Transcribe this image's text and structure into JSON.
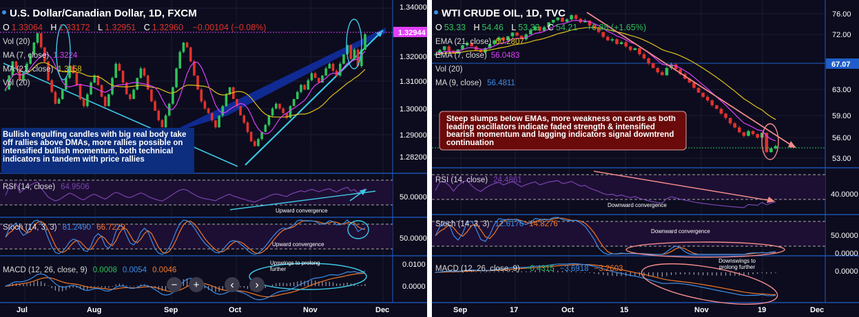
{
  "colors": {
    "background": "#0c0c1e",
    "pane_border": "#1f5ec9",
    "grid": "#1d1d33",
    "text": "#dadada",
    "bull": "#2fc15a",
    "bear": "#e0322d",
    "axis_text": "#ffffff",
    "price_line": "#e040fb",
    "annot_left_bg": "#0d2e7e",
    "annot_right_bg": "#6a0a0a",
    "cyan": "#3ec8e6",
    "salmon": "#f08a8a",
    "rsi_line": "#7a44b0",
    "stoch_k": "#3c8ee6",
    "stoch_d": "#f0782a",
    "ma7": "#e040fb",
    "ma21": "#e2c21a",
    "ema21": "#e2c21a",
    "ema7": "#e040fb",
    "ma9_vol": "#3c8ee6"
  },
  "left": {
    "header": {
      "title": "U.S. Dollar/Canadian Dollar, 1D, FXCM",
      "o_label": "O",
      "o": "1.33064",
      "h_label": "H",
      "h": "1.33172",
      "l_label": "L",
      "l": "1.32951",
      "c_label": "C",
      "c": "1.32960",
      "change": "−0.00104 (−0.08%)"
    },
    "legend": {
      "vol": "Vol (20)",
      "ma7_label": "MA (7, close)",
      "ma7_value": "1.3224",
      "ma21_label": "MA (21, close)",
      "ma21_value": "1.3158",
      "vol2": "Vol (20)"
    },
    "annotation": "Bullish engulfing candles with big real body take off rallies above DMAs, more rallies possible on intensified bullish momentum, both technical indicators in tandem with price rallies",
    "price_tag": "1.32944",
    "rsi": {
      "label": "RSI (14, close)",
      "value": "64.9506",
      "note": "Upward convergence"
    },
    "stoch": {
      "label": "Stoch (14, 3, 3)",
      "k": "81.2490",
      "d": "66.7229",
      "note": "Upward convergence"
    },
    "macd": {
      "label": "MACD (12, 26, close, 9)",
      "v1": "0.0008",
      "v2": "0.0054",
      "v3": "0.0046",
      "note": "Upswings to prolong further"
    },
    "toolbar": {
      "minus": "−",
      "plus": "+",
      "prev": "‹",
      "next": "›"
    }
  },
  "right": {
    "header": {
      "title": "WTI CRUDE OIL, 1D, TVC",
      "o_label": "O",
      "o": "53.33",
      "h_label": "H",
      "h": "54.46",
      "l_label": "L",
      "l": "53.33",
      "c_label": "C",
      "c": "54.21",
      "change": "+0.88 (+1.65%)"
    },
    "legend": {
      "ema21_label": "EMA (21, close)",
      "ema21_value": "60.2807",
      "ema7_label": "EMA (7, close)",
      "ema7_value": "56.0483",
      "vol": "Vol (20)",
      "ma9_label": "MA (9, close)",
      "ma9_value": "56.4811"
    },
    "annotation": "Steep slumps below EMAs, more weakness on cards as both leading oscillators indicate faded strength & intensified bearish momentum and lagging indicators signal downtrend continuation",
    "price_tag": "67.07",
    "rsi": {
      "label": "RSI (14, close)",
      "value": "24.4861",
      "note": "Downward convergence"
    },
    "stoch": {
      "label": "Stoch (14, 3, 3)",
      "k": "12.6176",
      "d": "14.8276",
      "note": "Downward convergence"
    },
    "macd": {
      "label": "MACD (12, 26, close, 9)",
      "v1": "−0.4315",
      "v2": "−3.6918",
      "v3": "−3.2603",
      "note": "Downswings to prolong further"
    }
  },
  "chart_data": [
    {
      "type": "candlestick",
      "title": "U.S. Dollar/Canadian Dollar, 1D, FXCM",
      "x_ticks": [
        "Jul",
        "Aug",
        "Sep",
        "Oct",
        "Nov",
        "Dec"
      ],
      "y_ticks": [
        "1.34000",
        "1.33000",
        "1.32000",
        "1.31000",
        "1.30000",
        "1.29000",
        "1.28200"
      ],
      "ylim": [
        1.2745,
        1.3415
      ],
      "close_series": [
        1.306,
        1.312,
        1.318,
        1.315,
        1.31,
        1.313,
        1.317,
        1.321,
        1.326,
        1.33,
        1.324,
        1.318,
        1.31,
        1.305,
        1.3,
        1.302,
        1.306,
        1.311,
        1.316,
        1.313,
        1.308,
        1.302,
        1.299,
        1.304,
        1.309,
        1.312,
        1.308,
        1.303,
        1.299,
        1.304,
        1.311,
        1.317,
        1.314,
        1.309,
        1.304,
        1.302,
        1.306,
        1.311,
        1.315,
        1.312,
        1.306,
        1.301,
        1.297,
        1.293,
        1.29,
        1.295,
        1.3,
        1.307,
        1.315,
        1.322,
        1.326,
        1.324,
        1.318,
        1.312,
        1.306,
        1.301,
        1.298,
        1.296,
        1.293,
        1.29,
        1.295,
        1.299,
        1.304,
        1.307,
        1.302,
        1.299,
        1.295,
        1.292,
        1.288,
        1.284,
        1.282,
        1.285,
        1.288,
        1.291,
        1.295,
        1.298,
        1.3,
        1.298,
        1.296,
        1.294,
        1.299,
        1.302,
        1.305,
        1.308,
        1.306,
        1.31,
        1.313,
        1.311,
        1.309,
        1.312,
        1.315,
        1.317,
        1.314,
        1.312,
        1.317,
        1.321,
        1.325,
        1.319,
        1.323,
        1.316,
        1.323,
        1.3296
      ],
      "rsi_value": 64.9506,
      "stoch": {
        "k": 81.249,
        "d": 66.7229
      },
      "macd": {
        "macd": 0.0054,
        "signal": 0.0046,
        "histogram": 0.0008
      },
      "annotations": [
        "Upward convergence",
        "Upward convergence",
        "Upswings to prolong further"
      ]
    },
    {
      "type": "candlestick",
      "title": "WTI CRUDE OIL, 1D, TVC",
      "x_ticks": [
        "Sep",
        "17",
        "Oct",
        "15",
        "Nov",
        "19",
        "Dec"
      ],
      "y_ticks": [
        "76.00",
        "72.00",
        "67.07",
        "63.00",
        "59.00",
        "56.00",
        "53.00"
      ],
      "ylim": [
        51.5,
        77.5
      ],
      "close_series": [
        69.5,
        70.2,
        70.8,
        70.1,
        69.6,
        70.3,
        71.0,
        71.4,
        70.8,
        70.2,
        69.8,
        70.5,
        71.2,
        71.8,
        72.3,
        71.8,
        72.5,
        73.1,
        72.6,
        72.0,
        72.8,
        73.5,
        74.1,
        73.4,
        74.0,
        74.8,
        75.2,
        75.6,
        74.9,
        75.3,
        76.0,
        75.4,
        74.8,
        75.1,
        74.3,
        73.8,
        73.2,
        72.4,
        71.8,
        72.0,
        71.2,
        71.5,
        70.8,
        70.2,
        70.5,
        69.5,
        68.8,
        68.0,
        67.2,
        66.5,
        66.0,
        67.2,
        67.8,
        67.0,
        66.2,
        65.4,
        64.8,
        63.9,
        63.1,
        62.4,
        61.8,
        61.0,
        60.4,
        59.6,
        58.9,
        58.0,
        57.3,
        56.5,
        55.9,
        56.7,
        56.2,
        55.6,
        56.4,
        53.2,
        53.8,
        54.21
      ],
      "ema21_value": 60.2807,
      "ema7_value": 56.0483,
      "rsi_value": 24.4861,
      "stoch": {
        "k": 12.6176,
        "d": 14.8276
      },
      "macd": {
        "histogram": -0.4315,
        "macd": -3.6918,
        "signal": -3.2603
      },
      "annotations": [
        "Downward convergence",
        "Downward convergence",
        "Downswings to prolong further"
      ]
    }
  ]
}
